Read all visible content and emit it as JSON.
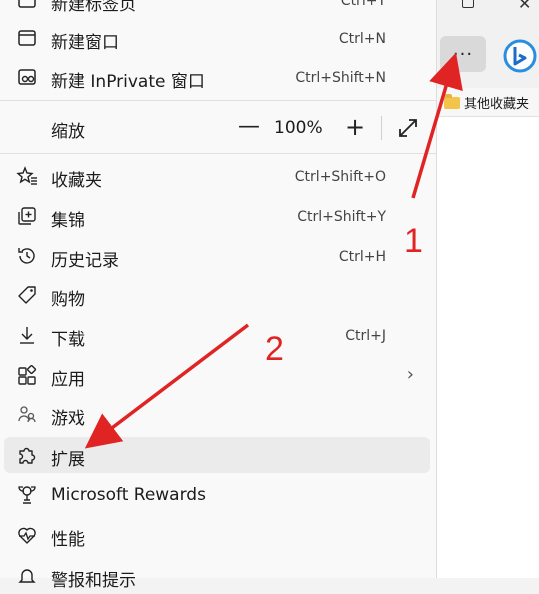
{
  "menu": {
    "items": [
      {
        "label": "新建标签页",
        "shortcut": "Ctrl+T",
        "icon": "new-tab-icon"
      },
      {
        "label": "新建窗口",
        "shortcut": "Ctrl+N",
        "icon": "new-window-icon"
      },
      {
        "label": "新建 InPrivate 窗口",
        "shortcut": "Ctrl+Shift+N",
        "icon": "inprivate-icon"
      },
      {
        "label": "收藏夹",
        "shortcut": "Ctrl+Shift+O",
        "icon": "star-icon"
      },
      {
        "label": "集锦",
        "shortcut": "Ctrl+Shift+Y",
        "icon": "collections-icon"
      },
      {
        "label": "历史记录",
        "shortcut": "Ctrl+H",
        "icon": "history-icon"
      },
      {
        "label": "购物",
        "shortcut": "",
        "icon": "tag-icon"
      },
      {
        "label": "下载",
        "shortcut": "Ctrl+J",
        "icon": "download-icon"
      },
      {
        "label": "应用",
        "shortcut": "",
        "icon": "apps-icon"
      },
      {
        "label": "游戏",
        "shortcut": "",
        "icon": "games-icon"
      },
      {
        "label": "扩展",
        "shortcut": "",
        "icon": "puzzle-icon"
      },
      {
        "label": "Microsoft Rewards",
        "shortcut": "",
        "icon": "trophy-icon"
      },
      {
        "label": "性能",
        "shortcut": "",
        "icon": "heartbeat-icon"
      },
      {
        "label": "警报和提示",
        "shortcut": "",
        "icon": "bell-icon"
      }
    ],
    "zoom": {
      "label": "缩放",
      "minus": "—",
      "value": "100%",
      "plus": "+"
    },
    "chevron": "›"
  },
  "toolbar": {
    "more_label": "···"
  },
  "bookmarks": {
    "folder_label": "其他收藏夹"
  },
  "annotations": {
    "arrow1_label": "1",
    "arrow2_label": "2",
    "color": "#e02424"
  }
}
